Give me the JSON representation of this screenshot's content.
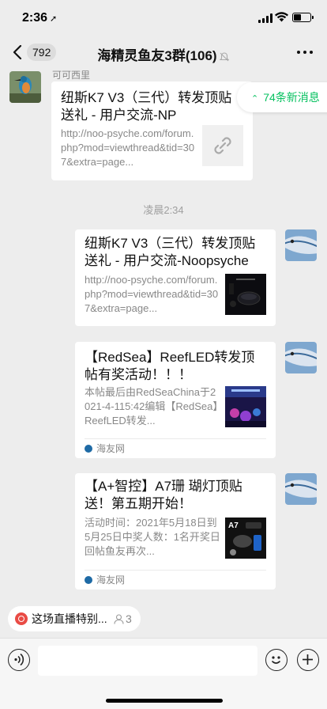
{
  "status": {
    "time": "2:36",
    "location_arrow": "➚"
  },
  "nav": {
    "back_count": "792",
    "title": "海精灵鱼友3群(106)",
    "icons": [
      "back-icon",
      "mute-icon",
      "more-icon"
    ]
  },
  "new_messages": {
    "label": "74条新消息"
  },
  "messages": [
    {
      "sender": "可可西里",
      "title": "纽斯K7 V3（三代）转发顶贴送礼 - 用户交流-NP",
      "desc": "http://noo-psyche.com/forum.php?mod=viewthread&tid=307&extra=page..."
    },
    {
      "title": "纽斯K7 V3（三代）转发顶贴送礼 - 用户交流-Noopsyche",
      "desc": "http://noo-psyche.com/forum.php?mod=viewthread&tid=307&extra=page..."
    },
    {
      "title": "【RedSea】ReefLED转发顶帖有奖活动！！！",
      "desc": "本帖最后由RedSeaChina于2021-4-115:42编辑【RedSea】ReefLED转发...",
      "source": "海友网"
    },
    {
      "title": "【A+智控】A7珊 瑚灯顶贴送！第五期开始！",
      "desc": "活动时间：2021年5月18日到5月25日中奖人数：1名开奖日回帖鱼友再次...",
      "source": "海友网",
      "thumb_label": "A7"
    }
  ],
  "timestamp": "凌晨2:34",
  "live": {
    "label": "这场直播特别...",
    "viewers": "3"
  },
  "colors": {
    "accent_green": "#07c160",
    "background": "#ededed",
    "live_red": "#e94b45"
  }
}
